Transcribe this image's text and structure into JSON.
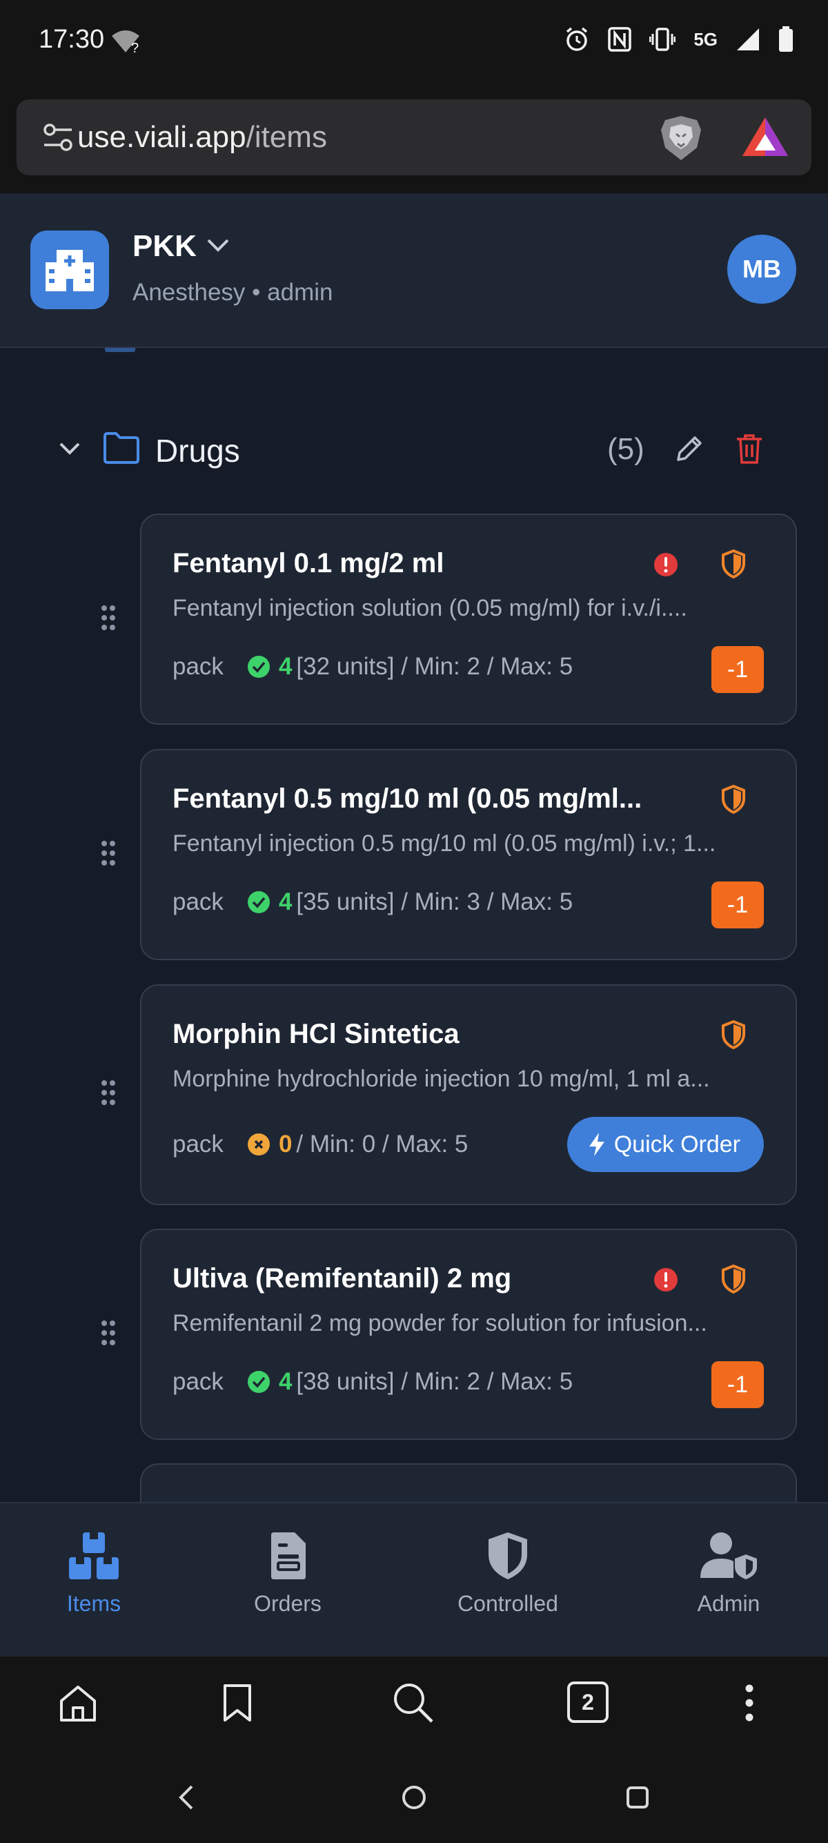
{
  "status_bar": {
    "time": "17:30",
    "network": "5G"
  },
  "url_bar": {
    "domain": "use.viali.app",
    "path": "/items"
  },
  "header": {
    "org_name": "PKK",
    "subtitle": "Anesthesy • admin",
    "avatar_initials": "MB"
  },
  "folder": {
    "name": "Drugs",
    "count": "(5)"
  },
  "items": [
    {
      "title": "Fentanyl 0.1 mg/2 ml",
      "description": "Fentanyl injection solution (0.05 mg/ml) for i.v./i....",
      "unit": "pack",
      "quantity": "4",
      "units": "[32 units]",
      "min": "/ Min: 2",
      "max": "/ Max: 5",
      "action": "-1",
      "alert": true,
      "status": "ok"
    },
    {
      "title": "Fentanyl 0.5 mg/10 ml (0.05 mg/ml...",
      "description": "Fentanyl injection 0.5 mg/10 ml (0.05 mg/ml) i.v.; 1...",
      "unit": "pack",
      "quantity": "4",
      "units": "[35 units]",
      "min": "/ Min: 3",
      "max": "/ Max: 5",
      "action": "-1",
      "alert": false,
      "status": "ok"
    },
    {
      "title": "Morphin HCl Sintetica",
      "description": "Morphine hydrochloride injection 10 mg/ml, 1 ml a...",
      "unit": "pack",
      "quantity": "0",
      "units": "",
      "min": "/ Min: 0",
      "max": "/ Max: 5",
      "action": "Quick Order",
      "alert": false,
      "status": "empty"
    },
    {
      "title": "Ultiva (Remifentanil) 2 mg",
      "description": "Remifentanil 2 mg powder for solution for infusion...",
      "unit": "pack",
      "quantity": "4",
      "units": "[38 units]",
      "min": "/ Min: 2",
      "max": "/ Max: 5",
      "action": "-1",
      "alert": true,
      "status": "ok"
    }
  ],
  "bottom_nav": [
    {
      "label": "Items",
      "icon": "boxes-icon",
      "active": true
    },
    {
      "label": "Orders",
      "icon": "clipboard-icon",
      "active": false
    },
    {
      "label": "Controlled",
      "icon": "shield-icon",
      "active": false
    },
    {
      "label": "Admin",
      "icon": "user-shield-icon",
      "active": false
    }
  ],
  "browser_bar": {
    "tab_count": "2"
  },
  "colors": {
    "accent": "#3f7fd9",
    "danger": "#e23b3b",
    "warning": "#f26b1d",
    "ok": "#3ed26a"
  }
}
